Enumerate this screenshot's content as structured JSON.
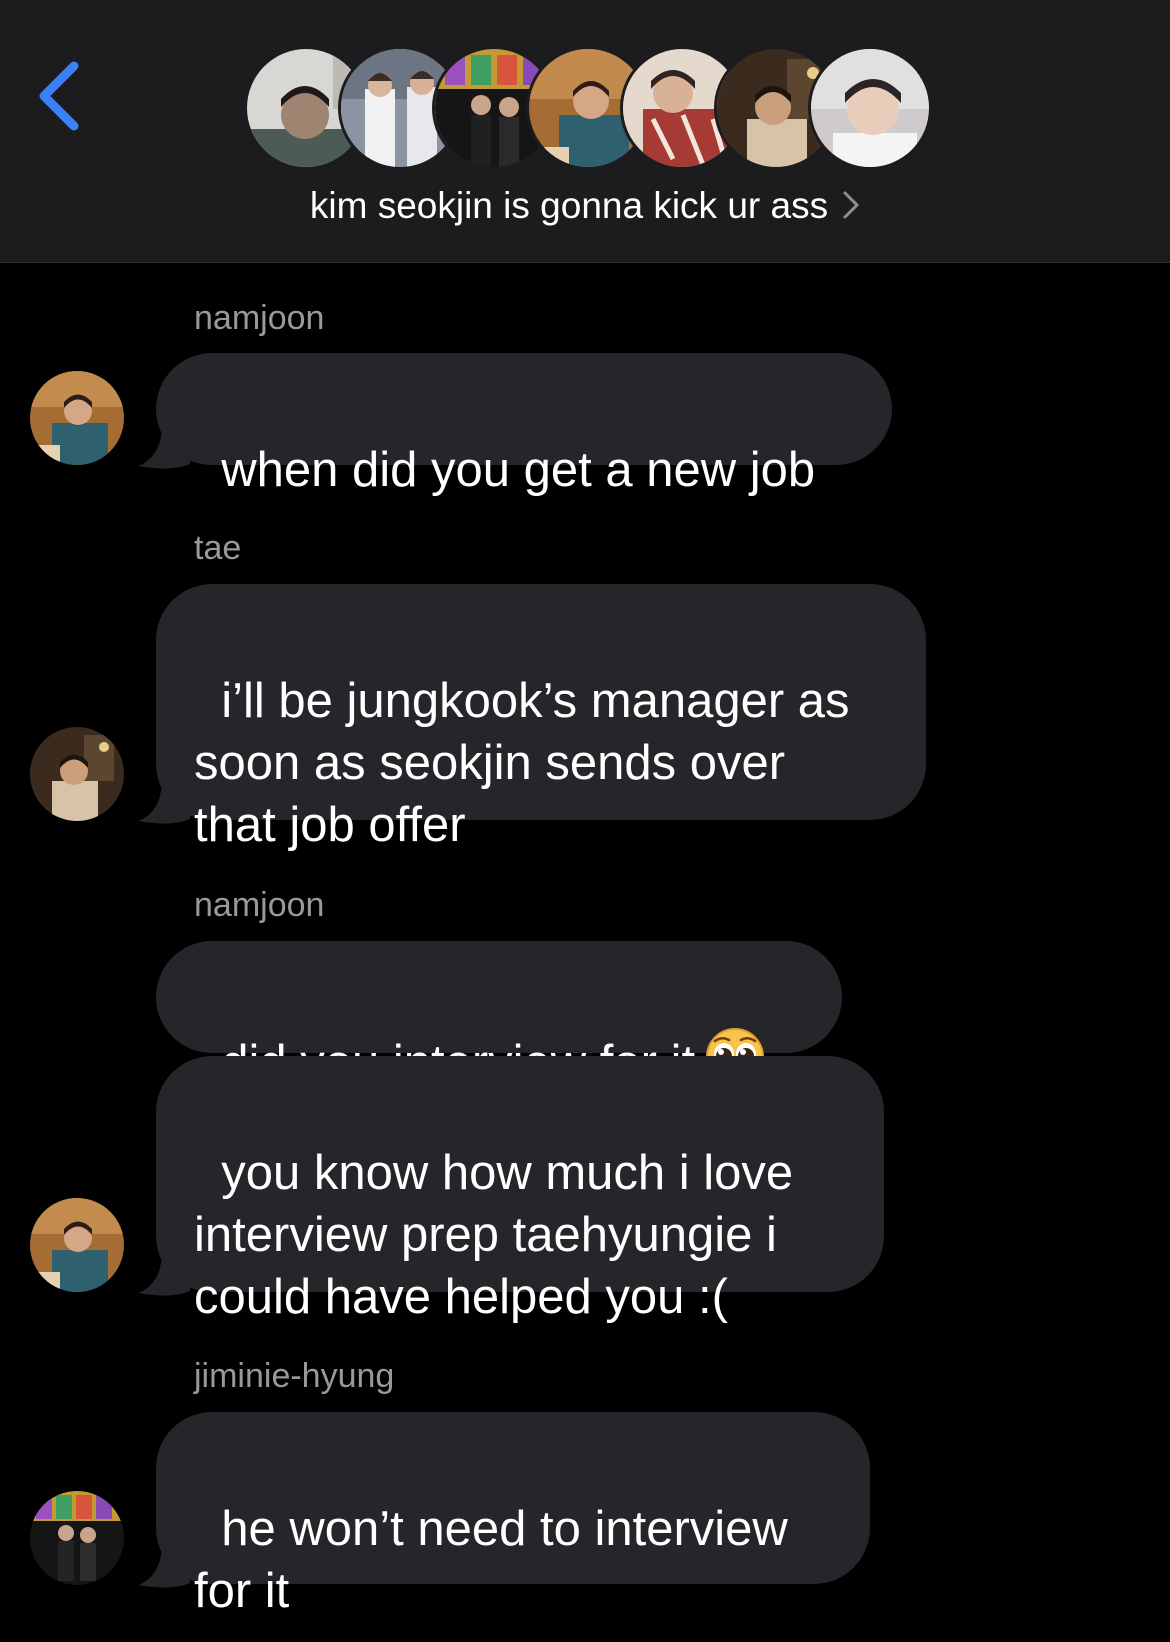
{
  "header": {
    "back_label": "Back",
    "group_title": "kim seokjin is gonna kick ur ass",
    "participants": [
      {
        "name": "participant-1",
        "colors": [
          "#cfcdca",
          "#5a5856",
          "#2d3a3f"
        ]
      },
      {
        "name": "participant-2",
        "colors": [
          "#e8e9ee",
          "#7b8290",
          "#9b9da6"
        ]
      },
      {
        "name": "participant-3",
        "colors": [
          "#1a1a1a",
          "#c19a3a",
          "#8d4bb0"
        ]
      },
      {
        "name": "participant-4",
        "colors": [
          "#b07a3c",
          "#2c5c6f",
          "#e7d4b3"
        ]
      },
      {
        "name": "participant-5",
        "colors": [
          "#e9dcd0",
          "#a33530",
          "#6a3a2a"
        ]
      },
      {
        "name": "participant-6",
        "colors": [
          "#3a2a1a",
          "#c5a37a",
          "#6d5236"
        ]
      },
      {
        "name": "participant-7",
        "colors": [
          "#d8d6d8",
          "#f2f2f2",
          "#2b2628"
        ]
      }
    ]
  },
  "messages": [
    {
      "sender": "namjoon",
      "texts": [
        "when did you get a new job"
      ]
    },
    {
      "sender": "tae",
      "texts": [
        "i’ll be jungkook’s manager as\nsoon as seokjin sends over\nthat job offer"
      ]
    },
    {
      "sender": "namjoon",
      "texts": [
        "did you interview for it",
        "you know how much i love\ninterview prep taehyungie i\ncould have helped you :("
      ],
      "emoji": "pleading-face"
    },
    {
      "sender": "jiminie-hyung",
      "texts": [
        "he won’t need to interview\nfor it"
      ]
    }
  ],
  "colors": {
    "background": "#000000",
    "header_bg": "#1c1c1e",
    "bubble_bg": "#26252a",
    "sender_text": "#98989d",
    "back_blue": "#3c82f6"
  }
}
